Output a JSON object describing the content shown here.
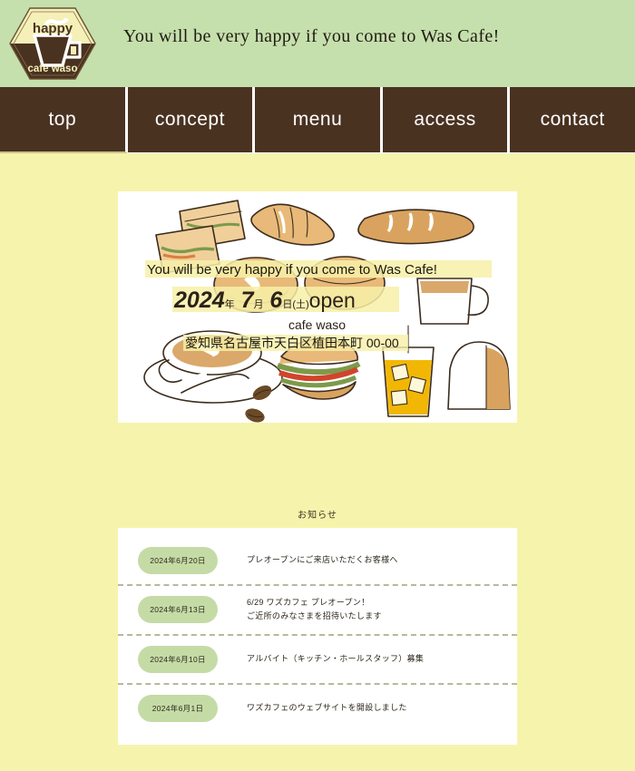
{
  "site": {
    "logo": {
      "top_text": "happy",
      "bottom_text": "cafe waso",
      "icon": "coffee-cup-icon"
    },
    "tagline": "You will be very happy if you come to Was Cafe!"
  },
  "colors": {
    "header_green": "#c5e0ac",
    "page_yellow": "#f6f4ac",
    "nav_brown": "#4a3221",
    "badge_green": "#c5dba6",
    "panel_white": "#ffffff",
    "highlight_yellow": "#f7f0a8"
  },
  "nav": {
    "items": [
      {
        "label": "top",
        "active": true
      },
      {
        "label": "concept",
        "active": false
      },
      {
        "label": "menu",
        "active": false
      },
      {
        "label": "access",
        "active": false
      },
      {
        "label": "contact",
        "active": false
      }
    ]
  },
  "hero": {
    "headline": "You will be very happy if you come to Was Cafe!",
    "open_date": {
      "year": "2024",
      "year_unit": "年",
      "month": "7",
      "month_unit": "月",
      "day": "6",
      "day_unit": "日",
      "weekday": "(土)",
      "open_label": "open"
    },
    "shop_name": "cafe waso",
    "address": "愛知県名古屋市天白区植田本町 00-00",
    "illustrations": [
      "sandwich-illustration",
      "croissant-illustration",
      "baguette-illustration",
      "bagel-illustration",
      "coffee-mug-illustration",
      "latte-cup-illustration",
      "hamburger-illustration",
      "iced-tea-illustration",
      "loaf-bread-illustration",
      "coffee-beans-illustration"
    ]
  },
  "news": {
    "title": "お知らせ",
    "items": [
      {
        "date": "2024年6月20日",
        "lines": [
          "プレオープンにご来店いただくお客様へ"
        ]
      },
      {
        "date": "2024年6月13日",
        "lines": [
          "6/29 ワズカフェ プレオープン！",
          "ご近所のみなさまを招待いたします"
        ]
      },
      {
        "date": "2024年6月10日",
        "lines": [
          "アルバイト（キッチン・ホールスタッフ）募集"
        ]
      },
      {
        "date": "2024年6月1日",
        "lines": [
          "ワズカフェのウェブサイトを開設しました"
        ]
      }
    ]
  }
}
